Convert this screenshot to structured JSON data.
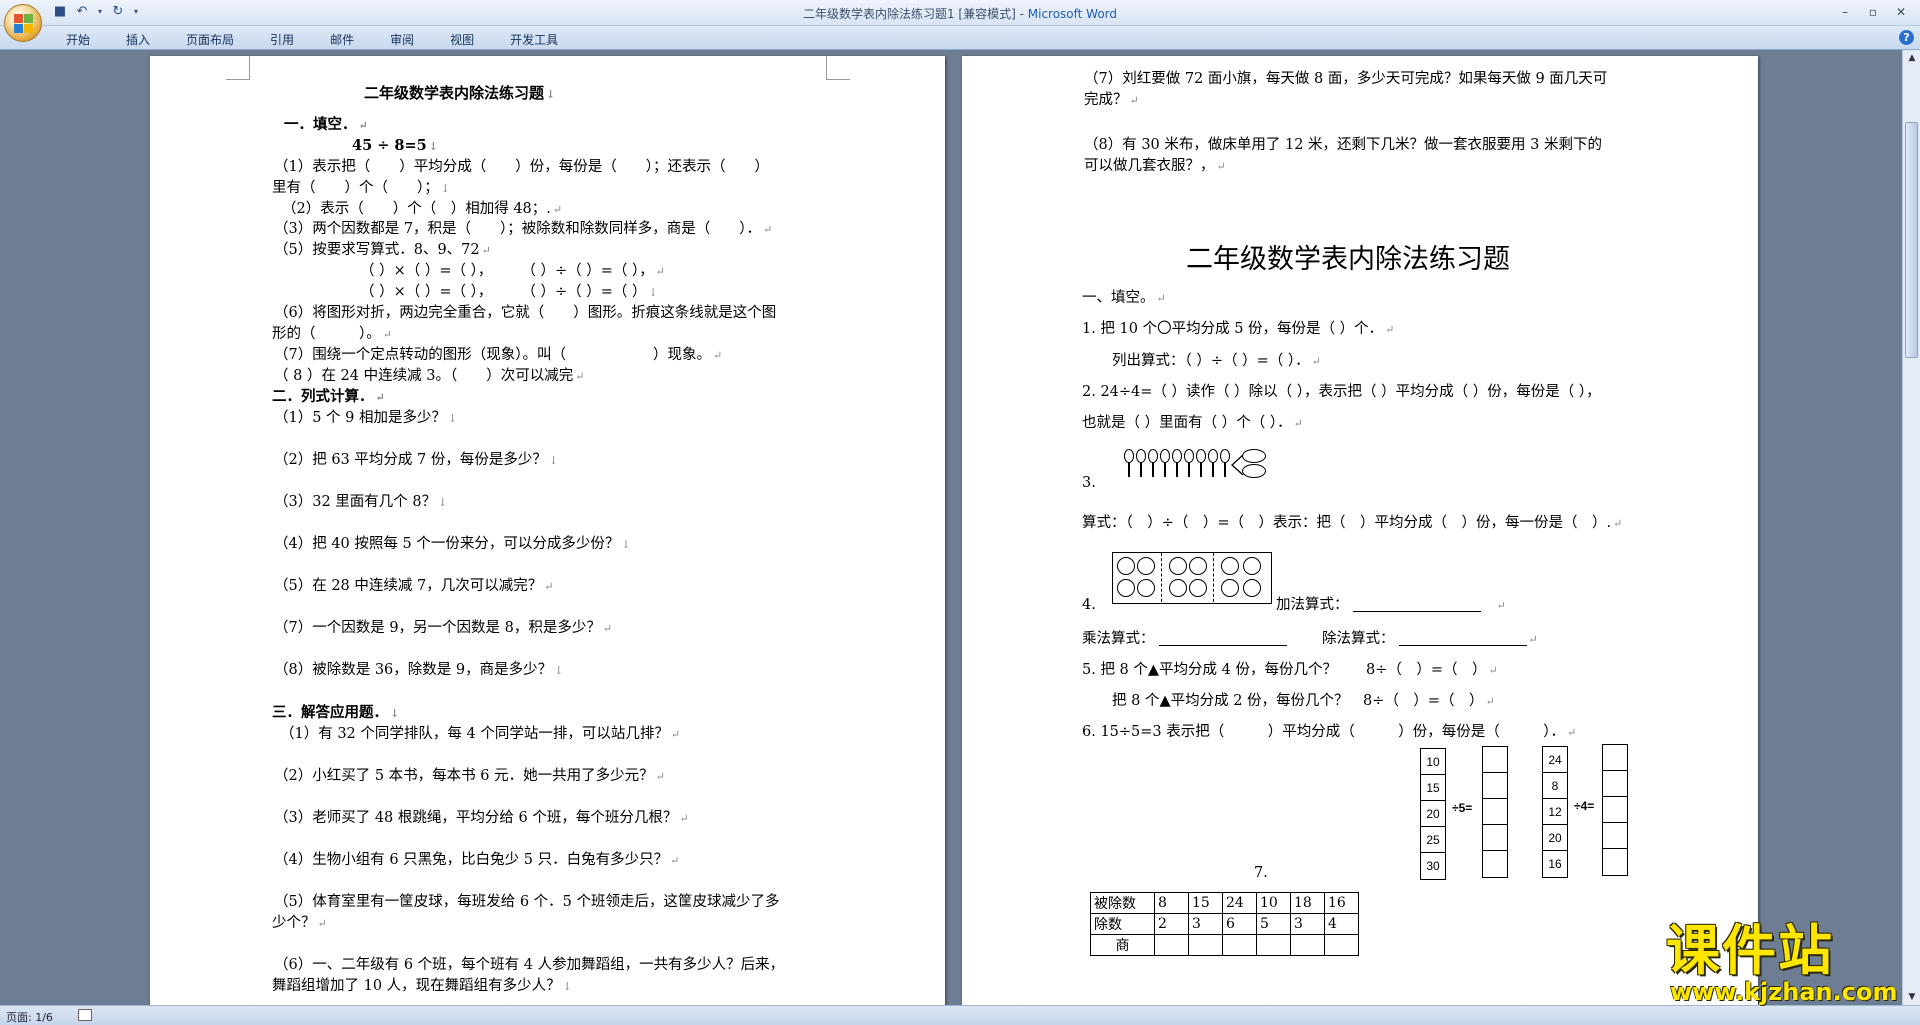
{
  "window": {
    "title": "二年级数学表内除法练习题1 [兼容模式] - ",
    "app_name": "Microsoft Word"
  },
  "ribbon": {
    "tabs": [
      "开始",
      "插入",
      "页面布局",
      "引用",
      "邮件",
      "审阅",
      "视图",
      "开发工具"
    ]
  },
  "status": {
    "page": "页面: 1/6"
  },
  "watermark": {
    "text": "课件站",
    "url": "www.kjzhan.com"
  },
  "page1": {
    "title": "二年级数学表内除法练习题",
    "s1": "一．填空．",
    "eq": "45 ÷ 8=5",
    "lines": [
      "（1）表示把（　　）平均分成（　　）份，每份是（　　）；还表示（　　）",
      "里有（　　）个（　　）；",
      "（2）表示（　　）个（　）相加得 48；.",
      "（3）两个因数都是 7，积是（　　）；被除数和除数同样多，商是（　　）．",
      "（5）按要求写算式．8、9、72",
      "（ ）×（ ）=（ ），　　　（ ）÷（ ）=（ ），",
      "（ ）×（ ）=（ ），　　　（ ）÷（ ）=（ ）",
      "（6）将图形对折，两边完全重合，它就（　　）图形。折痕这条线就是这个图",
      "形的（　　　）。",
      "（7）围绕一个定点转动的图形（现象）。叫（　　　　　　）现象。",
      "（ 8 ）在 24 中连续减 3。（　　）次可以减完"
    ],
    "s2": "二．列式计算．",
    "calc": [
      "（1）5 个 9 相加是多少？",
      "（2）把 63 平均分成 7 份，每份是多少？",
      "（3）32 里面有几个 8？",
      "（4）把 40 按照每 5 个一份来分，可以分成多少份？",
      "（5）在 28 中连续减 7，几次可以减完？",
      "（7）一个因数是 9，另一个因数是 8，积是多少？",
      "（8）被除数是 36，除数是 9，商是多少？"
    ],
    "s3": "三．解答应用题．",
    "apps": [
      "（1）有 32 个同学排队，每 4 个同学站一排，可以站几排？",
      "（2）小红买了 5 本书，每本书 6 元．她一共用了多少元？",
      "（3）老师买了 48 根跳绳，平均分给 6 个班，每个班分几根？",
      "（4）生物小组有 6 只黑兔，比白兔少 5 只．白兔有多少只？",
      "（5）体育室里有一筐皮球，每班发给 6 个．5 个班领走后，这筐皮球减少了多",
      "少个？",
      "（6）一、二年级有 6 个班，每个班有 4 人参加舞蹈组，一共有多少人？后来，",
      "舞蹈组增加了 10 人，现在舞蹈组有多少人？"
    ]
  },
  "page2": {
    "top": [
      "（7）刘红要做 72 面小旗，每天做 8 面，多少天可完成？如果每天做 9 面几天可",
      "完成？",
      "（8）有 30 米布，做床单用了 12 米，还剩下几米？做一套衣服要用 3 米剩下的",
      "可以做几套衣服？，"
    ],
    "title": "二年级数学表内除法练习题",
    "s1": "一、填空。",
    "q1": "1. 把 10 个〇平均分成 5 份，每份是（ ）个．",
    "q1b": "列出算式：（ ）÷（ ）=（ ）．",
    "q2": "2. 24÷4=（ ）读作（ ）除以（ ），表示把（ ）平均分成（ ）份，每份是（ ），",
    "q2b": "也就是（ ）里面有（ ）个（ ）．",
    "q3": "3.",
    "q3b": "算式：（　）÷（　）=（　）表示：把（　）平均分成（　）份，每一份是（　）.",
    "q4": "4.",
    "q4a": "加法算式：",
    "q4b": "乘法算式：",
    "q4c": "除法算式：",
    "q5": "5. 把 8 个▲平均分成 4 份，每份几个？　　8÷（　）=（　）",
    "q5b": "把 8 个▲平均分成 2 份，每份几个？　8÷（　）=（　）",
    "q6": "6. 15÷5=3 表示把（　　　）平均分成（　　　）份，每份是（　　　）．",
    "col_a": [
      "10",
      "15",
      "20",
      "25",
      "30"
    ],
    "col_a_op": "÷5=",
    "col_b": [
      "24",
      "8",
      "12",
      "20",
      "16"
    ],
    "col_b_op": "÷4=",
    "q7": "7.",
    "table": {
      "row1_label": "被除数",
      "row1": [
        "8",
        "15",
        "24",
        "10",
        "18",
        "16"
      ],
      "row2_label": "除数",
      "row2": [
        "2",
        "3",
        "6",
        "5",
        "3",
        "4"
      ],
      "row3_label": "商"
    }
  }
}
